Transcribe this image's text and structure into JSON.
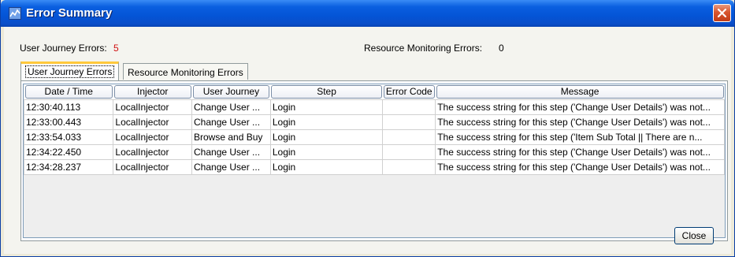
{
  "window": {
    "title": "Error Summary"
  },
  "summary": {
    "user_journey_errors_label": "User Journey Errors:",
    "user_journey_errors_count": "5",
    "user_journey_errors_color": "#d01010",
    "resource_monitoring_errors_label": "Resource Monitoring Errors:",
    "resource_monitoring_errors_count": "0"
  },
  "tabs": [
    {
      "label": "User Journey Errors",
      "active": true
    },
    {
      "label": "Resource Monitoring Errors",
      "active": false
    }
  ],
  "table": {
    "columns": [
      "Date / Time",
      "Injector",
      "User Journey",
      "Step",
      "Error Code",
      "Message"
    ],
    "rows": [
      [
        "12:30:40.113",
        "LocalInjector",
        "Change User ...",
        "Login",
        "",
        "The success string for this step ('Change User Details') was not..."
      ],
      [
        "12:33:00.443",
        "LocalInjector",
        "Change User ...",
        "Login",
        "",
        "The success string for this step ('Change User Details') was not..."
      ],
      [
        "12:33:54.033",
        "LocalInjector",
        "Browse and Buy",
        "Login",
        "",
        "The success string for this step ('Item Sub Total || There are n..."
      ],
      [
        "12:34:22.450",
        "LocalInjector",
        "Change User ...",
        "Login",
        "",
        "The success string for this step ('Change User Details') was not..."
      ],
      [
        "12:34:28.237",
        "LocalInjector",
        "Change User ...",
        "Login",
        "",
        "The success string for this step ('Change User Details') was not..."
      ]
    ]
  },
  "buttons": {
    "close_label": "Close"
  },
  "icons": {
    "app": "chart-icon",
    "titlebar_close": "close-icon"
  }
}
